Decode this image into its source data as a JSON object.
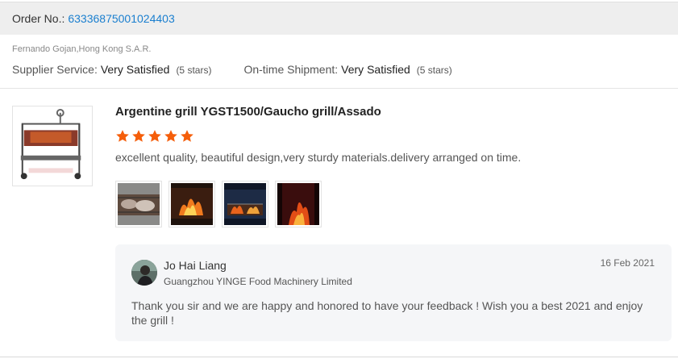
{
  "order": {
    "label": "Order No.:",
    "number": "63336875001024403"
  },
  "buyer": {
    "location": "Fernando Gojan,Hong Kong S.A.R."
  },
  "ratings": {
    "supplier_service": {
      "label": "Supplier Service:",
      "value": "Very Satisfied",
      "stars_text": "(5 stars)"
    },
    "shipment": {
      "label": "On-time Shipment:",
      "value": "Very Satisfied",
      "stars_text": "(5 stars)"
    }
  },
  "product": {
    "title": "Argentine grill YGST1500/Gaucho grill/Assado",
    "thumbnail_icon": "grill-product-photo"
  },
  "review": {
    "star_rating": 5,
    "star_color": "#f55e0a",
    "text": "excellent quality, beautiful design,very sturdy materials.delivery arranged on time.",
    "photos": [
      "grill-meat-photo",
      "fire-photo",
      "grill-fire-photo",
      "fire-closeup-photo"
    ]
  },
  "reply": {
    "name": "Jo Hai Liang",
    "company": "Guangzhou YINGE Food Machinery Limited",
    "date": "16 Feb 2021",
    "text": "Thank you sir and we are happy and honored to have your feedback ! Wish you a best 2021 and enjoy the grill !"
  },
  "colors": {
    "link": "#1a7fcf",
    "reply_bg": "#f5f6f8",
    "order_bar_bg": "#eeeeee"
  }
}
